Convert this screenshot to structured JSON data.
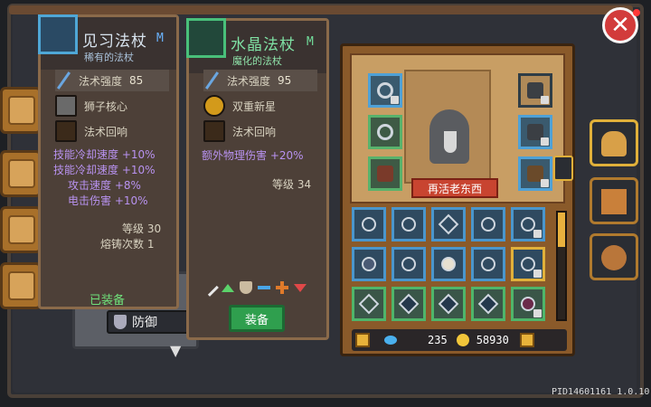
{
  "close_label": "✕",
  "background": {
    "defense_label": "防御"
  },
  "card_left": {
    "name": "见习法杖",
    "tier": "M",
    "subtitle": "稀有的法杖",
    "power_label": "法术强度",
    "power_value": "85",
    "perks": [
      "狮子核心",
      "法术回响"
    ],
    "stats": [
      "技能冷却速度 +10%",
      "技能冷却速度 +10%",
      "攻击速度 +8%",
      "电击伤害 +10%"
    ],
    "level_label": "等级 30",
    "forge_label": "熔铸次数 1",
    "status": "已装备"
  },
  "card_right": {
    "name": "水晶法杖",
    "tier": "M",
    "subtitle": "魔化的法杖",
    "power_label": "法术强度",
    "power_value": "95",
    "perks": [
      "双重新星",
      "法术回响"
    ],
    "stats": [
      "额外物理伤害 +20%"
    ],
    "level_label": "等级 34",
    "equip_button": "装备"
  },
  "equipment": {
    "hero_name": "再活老东西",
    "gems": "235",
    "gold": "58930"
  },
  "pid": "PID14601161 1.0.10",
  "colors": {
    "accent_gold": "#e0b03a",
    "rare_blue": "#4fa7d6",
    "magic_green": "#49c07a",
    "close_red": "#d23b3b"
  }
}
